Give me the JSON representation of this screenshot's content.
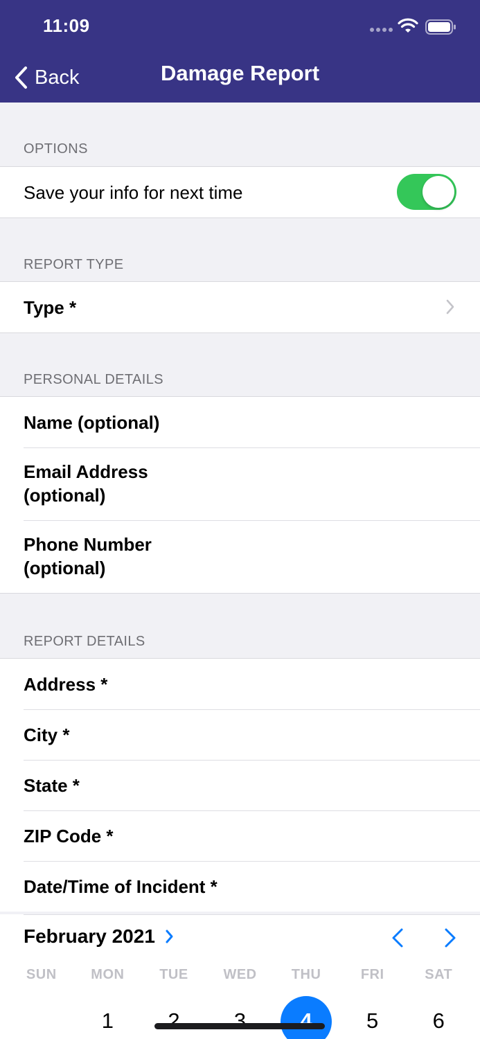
{
  "status_bar": {
    "time": "11:09"
  },
  "nav": {
    "back_label": "Back",
    "title": "Damage Report"
  },
  "sections": {
    "options": {
      "header": "OPTIONS",
      "save_info_label": "Save your info for next time",
      "save_info_enabled": true
    },
    "report_type": {
      "header": "REPORT TYPE",
      "type_label": "Type *"
    },
    "personal_details": {
      "header": "PERSONAL DETAILS",
      "name_label": "Name (optional)",
      "email_label": "Email Address (optional)",
      "phone_label": "Phone Number (optional)"
    },
    "report_details": {
      "header": "REPORT DETAILS",
      "address_label": "Address *",
      "city_label": "City *",
      "state_label": "State *",
      "zip_label": "ZIP Code *",
      "datetime_label": "Date/Time of Incident *"
    }
  },
  "calendar": {
    "month_label": "February 2021",
    "weekdays": [
      "SUN",
      "MON",
      "TUE",
      "WED",
      "THU",
      "FRI",
      "SAT"
    ],
    "first_week": [
      "",
      "1",
      "2",
      "3",
      "4",
      "5",
      "6"
    ],
    "selected_day": "4"
  },
  "colors": {
    "nav_bar": "#383485",
    "toggle_on": "#34c759",
    "accent": "#0a7cff",
    "background": "#f1f1f5"
  }
}
